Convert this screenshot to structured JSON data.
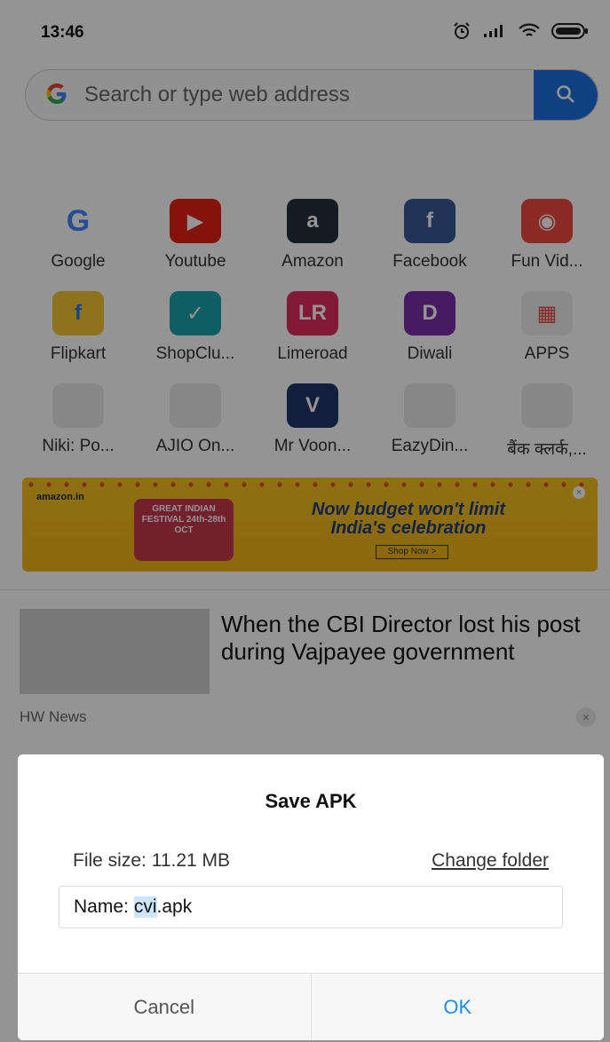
{
  "status": {
    "time": "13:46",
    "icons": [
      "alarm-icon",
      "signal-icon",
      "wifi-icon",
      "battery-icon"
    ]
  },
  "search": {
    "logo": "G",
    "placeholder": "Search or type web address",
    "button_icon": "search-icon",
    "accent": "#1e6fe0"
  },
  "shortcuts": [
    [
      {
        "label": "Google",
        "icon": "google-icon",
        "color": "#ffffff",
        "glyph": "G"
      },
      {
        "label": "Youtube",
        "icon": "youtube-icon",
        "color": "#e62117",
        "glyph": "▶"
      },
      {
        "label": "Amazon",
        "icon": "amazon-icon",
        "color": "#232f3e",
        "glyph": "a"
      },
      {
        "label": "Facebook",
        "icon": "facebook-icon",
        "color": "#3b5998",
        "glyph": "f"
      },
      {
        "label": "Fun Vid...",
        "icon": "fun-video-icon",
        "color": "#f0483e",
        "glyph": "◉"
      }
    ],
    [
      {
        "label": "Flipkart",
        "icon": "flipkart-icon",
        "color": "#f7c531",
        "glyph": "f"
      },
      {
        "label": "ShopClu...",
        "icon": "shopclues-icon",
        "color": "#1aa3a8",
        "glyph": "✓"
      },
      {
        "label": "Limeroad",
        "icon": "limeroad-icon",
        "color": "#e02b5c",
        "glyph": "LR"
      },
      {
        "label": "Diwali",
        "icon": "diwali-icon",
        "color": "#7a2fa8",
        "glyph": "D"
      },
      {
        "label": "APPS",
        "icon": "apps-icon",
        "color": "#eeeeee",
        "glyph": "▦"
      }
    ],
    [
      {
        "label": "Niki: Po...",
        "icon": "placeholder-app-icon",
        "color": "#e9e9e9",
        "glyph": ""
      },
      {
        "label": "AJIO On...",
        "icon": "placeholder-app-icon",
        "color": "#e9e9e9",
        "glyph": ""
      },
      {
        "label": "Mr Voon...",
        "icon": "mr-voonik-icon",
        "color": "#20346b",
        "glyph": "V"
      },
      {
        "label": "EazyDin...",
        "icon": "placeholder-app-icon",
        "color": "#e9e9e9",
        "glyph": ""
      },
      {
        "label": "बैंक क्लर्क,...",
        "icon": "placeholder-app-icon",
        "color": "#e9e9e9",
        "glyph": ""
      }
    ]
  ],
  "banner": {
    "brand": "amazon.in",
    "logo_text": "GREAT INDIAN FESTIVAL 24th-28th OCT",
    "headline_1": "Now budget won't limit",
    "headline_2": "India's celebration",
    "cta": "Shop Now >"
  },
  "news": {
    "title": "When the CBI Director lost his post during Vajpayee government",
    "source": "HW News"
  },
  "dialog": {
    "title": "Save APK",
    "file_size_label": "File size:",
    "file_size_value": "11.21 MB",
    "change_folder": "Change folder",
    "name_label": "Name:",
    "name_selected": "cvi",
    "name_ext": ".apk",
    "cancel": "Cancel",
    "ok": "OK"
  }
}
